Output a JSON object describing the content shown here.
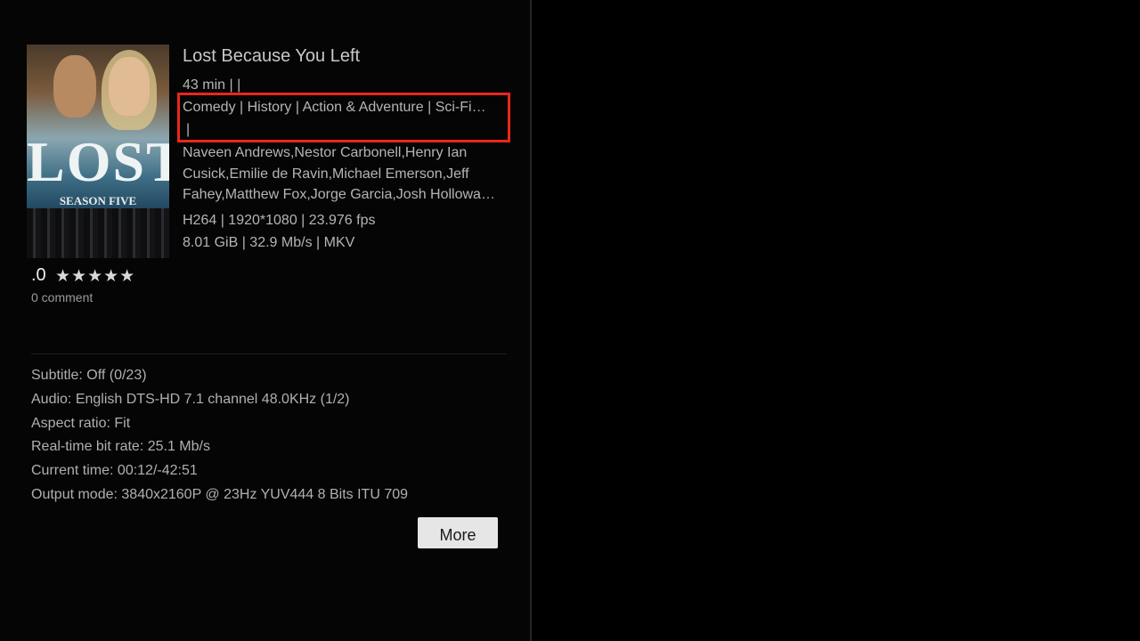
{
  "media": {
    "title": "Lost Because You Left",
    "poster_title": "LOST",
    "poster_subtitle": "SEASON FIVE",
    "duration_line": "43 min |  |",
    "genres": "Comedy | History | Action & Adventure | Sci-Fi…",
    "genres_extra": "|",
    "cast": "Naveen Andrews,Nestor Carbonell,Henry Ian Cusick,Emilie de Ravin,Michael Emerson,Jeff Fahey,Matthew Fox,Jorge Garcia,Josh Hollowa…",
    "video_line": "H264 | 1920*1080 | 23.976 fps",
    "file_line": "8.01 GiB | 32.9 Mb/s | MKV"
  },
  "rating": {
    "score": ".0",
    "stars": "★★★★★",
    "star_count": 5,
    "comments": "0 comment"
  },
  "playback": {
    "subtitle": "Subtitle:  Off (0/23)",
    "audio": "Audio:  English DTS-HD 7.1 channel 48.0KHz (1/2)",
    "aspect": "Aspect ratio:  Fit",
    "bitrate": "Real-time bit rate:  25.1 Mb/s",
    "time": "Current time:  00:12/-42:51",
    "output": "Output mode:  3840x2160P @ 23Hz  YUV444  8 Bits  ITU 709"
  },
  "buttons": {
    "more": "More"
  },
  "colors": {
    "highlight": "#e8271c",
    "background": "#000000",
    "button": "#e6e6e6"
  }
}
